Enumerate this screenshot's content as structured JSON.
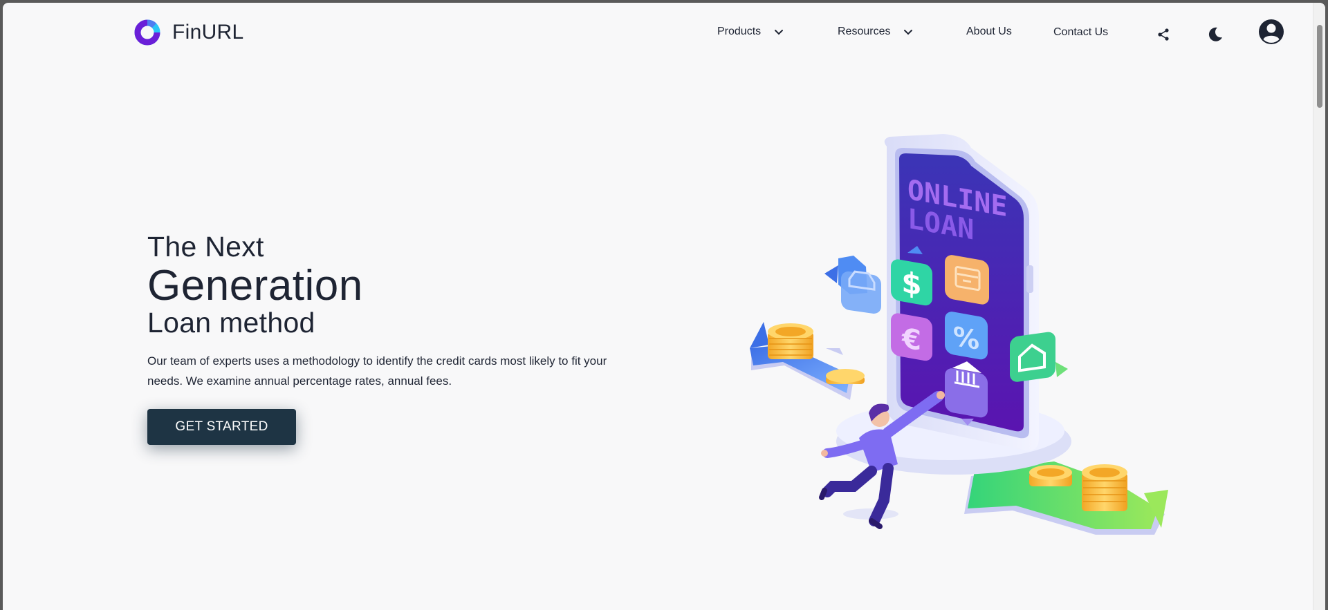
{
  "brand": {
    "name": "FinURL"
  },
  "nav": {
    "items": [
      {
        "label": "Products",
        "has_dropdown": true
      },
      {
        "label": "Resources",
        "has_dropdown": true
      },
      {
        "label": "About Us",
        "has_dropdown": false
      },
      {
        "label": "Contact Us",
        "has_dropdown": false
      }
    ],
    "icons": [
      "share-icon",
      "moon-icon",
      "account-icon"
    ]
  },
  "hero": {
    "title_line1": "The Next",
    "title_line2": "Generation",
    "title_line3": "Loan method",
    "description": "Our team of experts uses a methodology to identify the credit cards most likely to fit your needs. We examine annual percentage rates, annual fees.",
    "cta_label": "GET STARTED"
  },
  "illustration": {
    "screen_text": [
      "ONLINE",
      "LOAN"
    ],
    "tile_icons": [
      "car-icon",
      "dollar-icon",
      "calendar-icon",
      "euro-icon",
      "percent-icon",
      "bank-icon",
      "home-icon"
    ]
  },
  "colors": {
    "background": "#f8f8f9",
    "text": "#1e2433",
    "cta_background": "#1e3444",
    "logo_purple": "#6a1fd8",
    "logo_cyan": "#29c5f6"
  }
}
